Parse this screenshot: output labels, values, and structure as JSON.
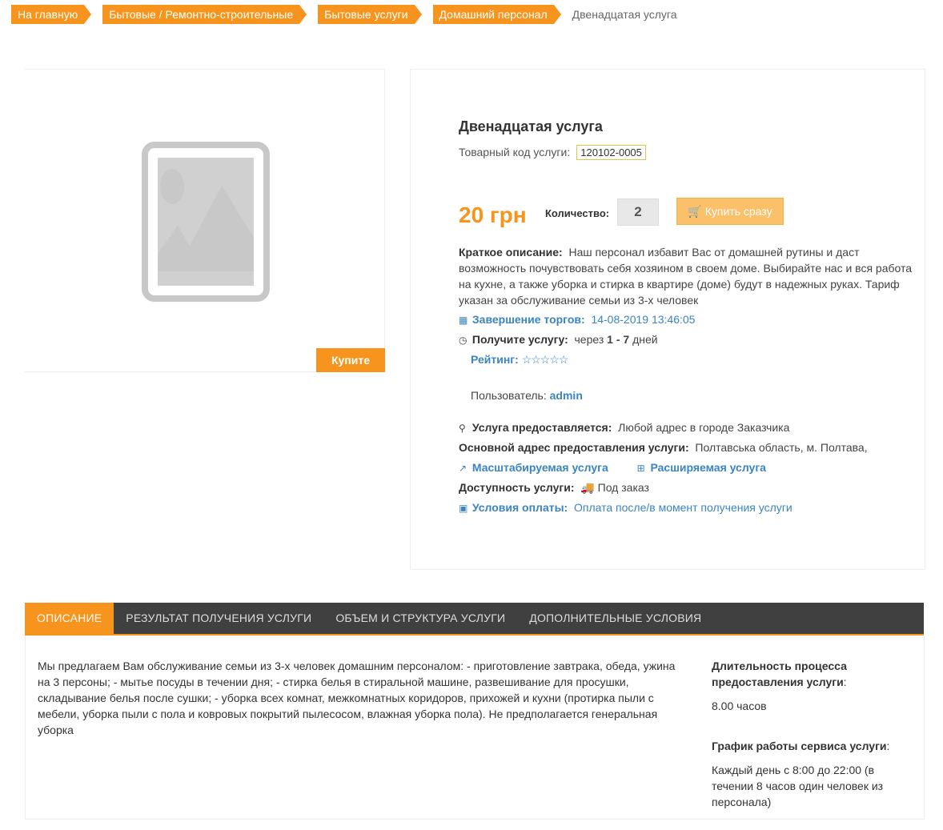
{
  "breadcrumbs": [
    "На главную",
    "Бытовые / Ремонтно-строительные",
    "Бытовые услуги",
    "Домашний персонал"
  ],
  "breadcrumb_current": "Двенадцатая услуга",
  "image": {
    "buy_label": "Купите"
  },
  "product": {
    "title": "Двенадцатая услуга",
    "code_label": "Товарный код услуги:",
    "code": "120102-0005",
    "price": "20 грн",
    "qty_label": "Количество:",
    "qty": "2",
    "buy_now": "Купить сразу",
    "short_label": "Краткое описание:",
    "short_text": "Наш персонал избавит Вас от домашней рутины и даст возможность почувствовать себя хозяином в своем доме. Выбирайте нас и вся работа на кухне, а также уборка и стирка в квартире (доме) будут в надежных руках. Тариф указан за обслуживание семьи из 3-х человек",
    "auction_label": "Завершение торгов:",
    "auction_value": "14-08-2019 13:46:05",
    "receive_label": "Получите услугу:",
    "receive_pre": "через",
    "receive_range": "1 - 7",
    "receive_post": "дней",
    "rating_label": "Рейтинг:",
    "rating_stars": "☆☆☆☆☆",
    "rating_value": 0,
    "user_label": "Пользователь:",
    "user_name": "admin",
    "provided_label": "Услуга предоставляется:",
    "provided_value": "Любой адрес в городе Заказчика",
    "address_label": "Основной адрес предоставления услуги:",
    "address_value": "Полтавська область, м. Полтава,",
    "scalable": "Масштабируемая услуга",
    "extendable": "Расширяемая услуга",
    "avail_label": "Доступность услуги:",
    "avail_value": "Под заказ",
    "payment_label": "Условия оплаты:",
    "payment_value": "Оплата после/в момент получения услуги"
  },
  "tabs": [
    "ОПИСАНИЕ",
    "РЕЗУЛЬТАТ ПОЛУЧЕНИЯ УСЛУГИ",
    "ОБЪЕМ И СТРУКТУРА УСЛУГИ",
    "ДОПОЛНИТЕЛЬНЫЕ УСЛОВИЯ"
  ],
  "description": "Мы предлагаем Вам обслуживание семьи из 3-х человек домашним персоналом: - приготовление завтрака, обеда, ужина на 3 персоны; - мытье посуды в течении дня; - стирка белья в стиральной машине, развешивание для просушки, складывание белья после сушки; - уборка всех комнат, межкомнатных коридоров, прихожей и кухни (протирка пыли с мебели, уборка пыли с пола и ковровых покрытий пылесосом, влажная уборка пола). Не предполагается генеральная уборка",
  "side": {
    "duration_label": "Длительность процесса предоставления услуги",
    "duration_value": "8.00 часов",
    "schedule_label": "График работы сервиса услуги",
    "schedule_value": "Каждый день с 8:00 до 22:00 (в течении 8 часов один человек из персонала)"
  },
  "colors": {
    "accent": "#f7941d",
    "link": "#3a85c1",
    "tabbar": "#404040"
  }
}
